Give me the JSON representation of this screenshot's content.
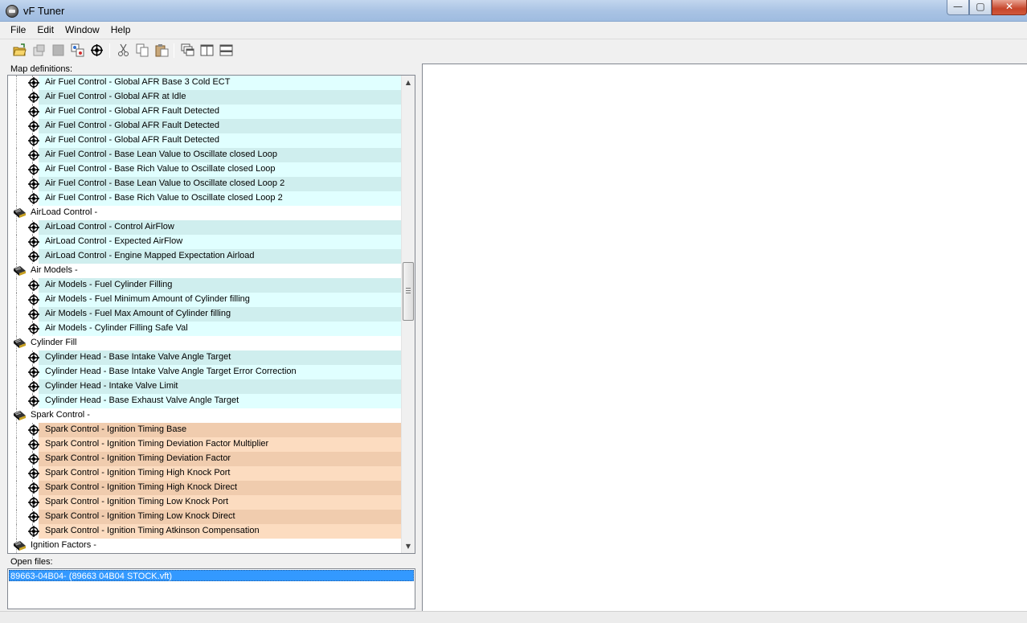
{
  "window": {
    "title": "vF Tuner",
    "minimize_glyph": "—",
    "maximize_glyph": "▢",
    "close_glyph": "✕"
  },
  "menu": {
    "items": [
      "File",
      "Edit",
      "Window",
      "Help"
    ]
  },
  "toolbar": {
    "buttons": [
      "open-folder-icon",
      "properties-icon",
      "stop-icon",
      "compare-icon",
      "add-map-icon",
      "cut-icon",
      "copy-icon",
      "paste-icon",
      "cascade-windows-icon",
      "tile-vertical-icon",
      "tile-horizontal-icon"
    ]
  },
  "map_definitions": {
    "label": "Map definitions:",
    "rows": [
      {
        "type": "child",
        "label": "Air Fuel Control - Global AFR Base 3 Cold ECT",
        "color": "#e0ffff"
      },
      {
        "type": "child",
        "label": "Air Fuel Control - Global AFR at Idle",
        "color": "#cfeeee"
      },
      {
        "type": "child",
        "label": "Air Fuel Control - Global AFR Fault Detected",
        "color": "#e0ffff"
      },
      {
        "type": "child",
        "label": "Air Fuel Control - Global AFR Fault Detected",
        "color": "#cfeeee"
      },
      {
        "type": "child",
        "label": "Air Fuel Control - Global AFR Fault Detected",
        "color": "#e0ffff"
      },
      {
        "type": "child",
        "label": "Air Fuel Control - Base Lean Value to Oscillate closed Loop",
        "color": "#cfeeee"
      },
      {
        "type": "child",
        "label": "Air Fuel Control - Base Rich Value to Oscillate closed Loop",
        "color": "#e0ffff"
      },
      {
        "type": "child",
        "label": "Air Fuel Control - Base Lean Value to Oscillate closed Loop 2",
        "color": "#cfeeee"
      },
      {
        "type": "child",
        "label": "Air Fuel Control - Base Rich Value to Oscillate closed Loop 2",
        "color": "#e0ffff"
      },
      {
        "type": "group",
        "label": "AirLoad Control -"
      },
      {
        "type": "child",
        "label": "AirLoad Control - Control AirFlow",
        "color": "#cfeeee"
      },
      {
        "type": "child",
        "label": "AirLoad Control - Expected AirFlow",
        "color": "#e0ffff"
      },
      {
        "type": "child",
        "label": "AirLoad Control - Engine Mapped Expectation Airload",
        "color": "#cfeeee"
      },
      {
        "type": "group",
        "label": "Air Models -"
      },
      {
        "type": "child",
        "label": "Air Models - Fuel Cylinder Filling",
        "color": "#cfeeee"
      },
      {
        "type": "child",
        "label": "Air Models - Fuel Minimum Amount of Cylinder filling",
        "color": "#e0ffff"
      },
      {
        "type": "child",
        "label": "Air Models - Fuel Max Amount of Cylinder filling",
        "color": "#cfeeee"
      },
      {
        "type": "child",
        "label": "Air Models - Cylinder Filling Safe Val",
        "color": "#e0ffff"
      },
      {
        "type": "group",
        "label": "Cylinder Fill"
      },
      {
        "type": "child",
        "label": "Cylinder Head - Base Intake Valve Angle Target",
        "color": "#cfeeee"
      },
      {
        "type": "child",
        "label": "Cylinder Head - Base Intake Valve Angle Target Error Correction",
        "color": "#e0ffff"
      },
      {
        "type": "child",
        "label": "Cylinder Head - Intake Valve Limit",
        "color": "#cfeeee"
      },
      {
        "type": "child",
        "label": "Cylinder Head - Base Exhaust Valve Angle Target",
        "color": "#e0ffff"
      },
      {
        "type": "group",
        "label": "Spark Control -"
      },
      {
        "type": "child",
        "label": "Spark Control - Ignition Timing Base",
        "color": "#f0ccae"
      },
      {
        "type": "child",
        "label": "Spark Control - Ignition Timing Deviation Factor Multiplier",
        "color": "#fcdcc0"
      },
      {
        "type": "child",
        "label": "Spark Control - Ignition Timing Deviation Factor",
        "color": "#f0ccae"
      },
      {
        "type": "child",
        "label": "Spark Control - Ignition Timing High Knock Port",
        "color": "#fcdcc0"
      },
      {
        "type": "child",
        "label": "Spark Control - Ignition Timing High Knock Direct",
        "color": "#f0ccae"
      },
      {
        "type": "child",
        "label": "Spark Control - Ignition Timing Low Knock Port",
        "color": "#fcdcc0"
      },
      {
        "type": "child",
        "label": "Spark Control - Ignition Timing Low Knock Direct",
        "color": "#f0ccae"
      },
      {
        "type": "child",
        "label": "Spark Control - Ignition Timing Atkinson Compensation",
        "color": "#fcdcc0"
      },
      {
        "type": "group",
        "label": "Ignition Factors -"
      }
    ]
  },
  "open_files": {
    "label": "Open files:",
    "items": [
      "89663-04B04- (89663 04B04 STOCK.vft)"
    ]
  }
}
